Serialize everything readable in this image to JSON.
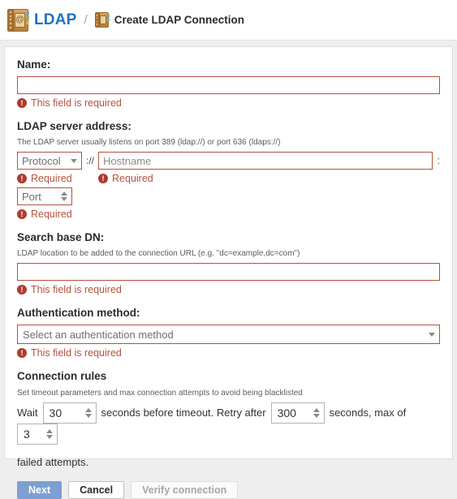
{
  "breadcrumb": {
    "app_icon": "address-book-icon",
    "app_label": "LDAP",
    "separator": "/",
    "page_icon": "address-book-icon",
    "page_label": "Create LDAP Connection"
  },
  "form": {
    "name": {
      "label": "Name:",
      "value": "",
      "error": "This field is required"
    },
    "server_address": {
      "label": "LDAP server address:",
      "help": "The LDAP server usually listens on port 389 (ldap://) or port 636 (ldaps://)",
      "protocol": {
        "value": "Protocol",
        "error": "Required"
      },
      "protocol_separator": "://",
      "hostname": {
        "placeholder": "Hostname",
        "value": "",
        "error": "Required"
      },
      "colon": ":",
      "port": {
        "value": "Port",
        "error": "Required"
      }
    },
    "search_base_dn": {
      "label": "Search base DN:",
      "help": "LDAP location to be added to the connection URL (e.g. \"dc=example,dc=com\")",
      "value": "",
      "error": "This field is required"
    },
    "auth_method": {
      "label": "Authentication method:",
      "value": "Select an authentication method",
      "error": "This field is required"
    },
    "connection_rules": {
      "label": "Connection rules",
      "help": "Set timeout parameters and max connection attempts to avoid being blacklisted",
      "text_wait": "Wait",
      "wait_seconds": "30",
      "text_before_timeout": "seconds before timeout. Retry after",
      "retry_seconds": "300",
      "text_seconds_max": "seconds, max of",
      "max_attempts": "3",
      "text_failed_attempts": "failed attempts."
    }
  },
  "actions": {
    "next": "Next",
    "cancel": "Cancel",
    "verify": "Verify connection"
  },
  "colors": {
    "link": "#1f6fc4",
    "error": "#b5513f",
    "error_icon": "#b03a2e",
    "primary_button": "#7d9fd4",
    "page_background": "#eeeeee"
  },
  "icons": {
    "error": "!",
    "dropdown": "chevron-down-icon",
    "spinner": "spinner-arrows-icon"
  }
}
